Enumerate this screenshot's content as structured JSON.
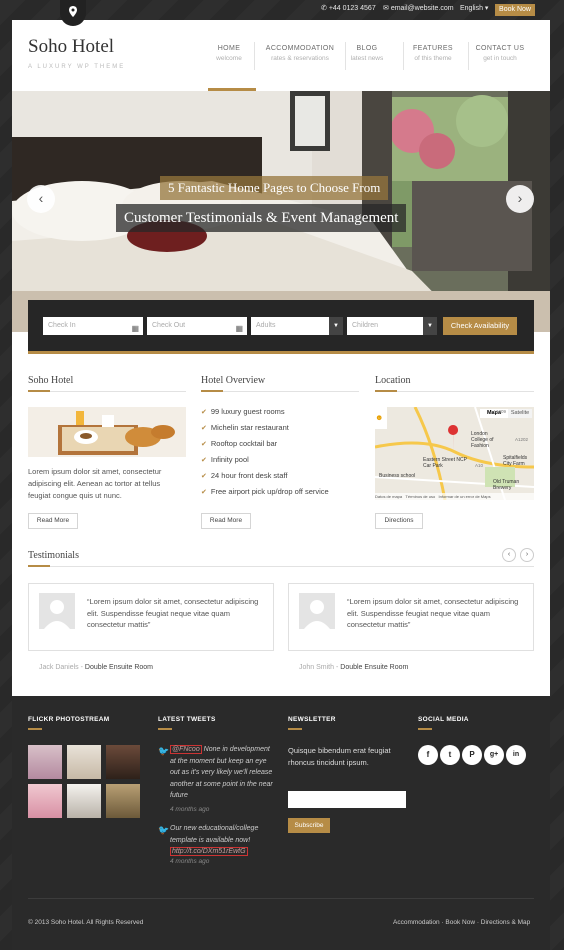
{
  "topbar": {
    "phone": "+44 0123 4567",
    "email": "email@website.com",
    "language": "English",
    "book_now": "Book Now"
  },
  "header": {
    "logo": "Soho Hotel",
    "tagline": "A LUXURY WP THEME"
  },
  "nav": [
    {
      "label": "HOME",
      "sub": "welcome"
    },
    {
      "label": "ACCOMMODATION",
      "sub": "rates & reservations"
    },
    {
      "label": "BLOG",
      "sub": "latest news"
    },
    {
      "label": "FEATURES",
      "sub": "of this theme"
    },
    {
      "label": "CONTACT US",
      "sub": "get in touch"
    }
  ],
  "hero": {
    "line1": "5 Fantastic Home Pages to Choose From",
    "line2": "Customer Testimonials & Event Management"
  },
  "booking": {
    "check_in": "Check In",
    "check_out": "Check Out",
    "adults": "Adults",
    "children": "Children",
    "submit": "Check Availability"
  },
  "about": {
    "title": "Soho Hotel",
    "text": "Lorem ipsum dolor sit amet, consectetur adipiscing elit. Aenean ac tortor at tellus feugiat congue quis ut nunc.",
    "button": "Read More"
  },
  "overview": {
    "title": "Hotel Overview",
    "items": [
      "99 luxury guest rooms",
      "Michelin star restaurant",
      "Rooftop cocktail bar",
      "Infinity pool",
      "24 hour front desk staff",
      "Free airport pick up/drop off service"
    ],
    "button": "Read More"
  },
  "location": {
    "title": "Location",
    "map_tab1": "Mapa",
    "map_tab2": "Satelite",
    "map_labels": {
      "a": "London College of Fashion",
      "b": "Eastern Street NCP Car Park",
      "c": "Spitalfields City Farm",
      "d": "Old Truman Brewery",
      "e": "Business school",
      "f": "Datos de mapa",
      "g": "Términos de uso",
      "h": "Informar de un error de Maps",
      "road1": "A1209",
      "road2": "A10",
      "road3": "A1202"
    },
    "button": "Directions"
  },
  "testimonials": {
    "title": "Testimonials",
    "items": [
      {
        "quote": "“Lorem ipsum dolor sit amet, consectetur adipiscing elit. Suspendisse feugiat neque vitae quam consectetur mattis”",
        "name": "Jack Daniels",
        "room": "Double Ensuite Room"
      },
      {
        "quote": "“Lorem ipsum dolor sit amet, consectetur adipiscing elit. Suspendisse feugiat neque vitae quam consectetur mattis”",
        "name": "John Smith",
        "room": "Double Ensuite Room"
      }
    ]
  },
  "footer": {
    "flickr_title": "FLICKR PHOTOSTREAM",
    "tweets_title": "LATEST TWEETS",
    "newsletter_title": "NEWSLETTER",
    "social_title": "SOCIAL MEDIA",
    "tweet1_handle": "@FNcoo",
    "tweet1_text": " None in development at the moment but keep an eye out as it's very likely we'll release another at some point in the near future",
    "tweet1_time": "4 months ago",
    "tweet2_text": "Our new educational/college template is available now! ",
    "tweet2_link": "http://t.co/DXm51rEwtG",
    "tweet2_time": "4 months ago",
    "newsletter_text": "Quisque bibendum erat feugiat rhoncus tincidunt ipsum.",
    "subscribe": "Subscribe",
    "social_icons": [
      "facebook-icon",
      "twitter-icon",
      "pinterest-icon",
      "google-plus-icon",
      "linkedin-icon"
    ],
    "copyright": "© 2013 Soho Hotel. All Rights Reserved",
    "links": [
      "Accommodation",
      "Book Now",
      "Directions & Map"
    ]
  },
  "colors": {
    "accent": "#b68c46",
    "dark": "#262626",
    "footer_bg": "#2b2b2b"
  }
}
